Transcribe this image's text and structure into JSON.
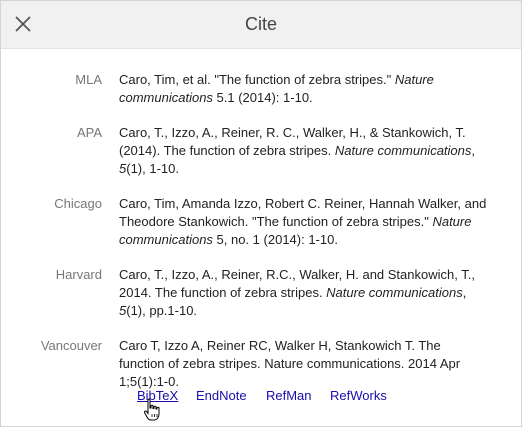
{
  "dialog": {
    "title": "Cite",
    "close_icon": "close-icon"
  },
  "citations": [
    {
      "style": "MLA",
      "parts": [
        {
          "t": "Caro, Tim, et al. \"The function of zebra stripes.\" "
        },
        {
          "t": "Nature communications",
          "i": true
        },
        {
          "t": " 5.1 (2014): 1-10."
        }
      ]
    },
    {
      "style": "APA",
      "parts": [
        {
          "t": "Caro, T., Izzo, A., Reiner, R. C., Walker, H., & Stankowich, T. (2014). The function of zebra stripes. "
        },
        {
          "t": "Nature communications",
          "i": true
        },
        {
          "t": ", "
        },
        {
          "t": "5",
          "i": true
        },
        {
          "t": "(1), 1-10."
        }
      ]
    },
    {
      "style": "Chicago",
      "parts": [
        {
          "t": "Caro, Tim, Amanda Izzo, Robert C. Reiner, Hannah Walker, and Theodore Stankowich. \"The function of zebra stripes.\" "
        },
        {
          "t": "Nature communications",
          "i": true
        },
        {
          "t": " 5, no. 1 (2014): 1-10."
        }
      ]
    },
    {
      "style": "Harvard",
      "parts": [
        {
          "t": "Caro, T., Izzo, A., Reiner, R.C., Walker, H. and Stankowich, T., 2014. The function of zebra stripes. "
        },
        {
          "t": "Nature communications",
          "i": true
        },
        {
          "t": ", "
        },
        {
          "t": "5",
          "i": true
        },
        {
          "t": "(1), pp.1-10."
        }
      ]
    },
    {
      "style": "Vancouver",
      "parts": [
        {
          "t": "Caro T, Izzo A, Reiner RC, Walker H, Stankowich T. The function of zebra stripes. Nature communications. 2014 Apr 1;5(1):1-0."
        }
      ]
    }
  ],
  "export_links": [
    "BibTeX",
    "EndNote",
    "RefMan",
    "RefWorks"
  ],
  "colors": {
    "link": "#1a0dab",
    "label": "#777777",
    "header_bg": "#f1f1f1"
  }
}
